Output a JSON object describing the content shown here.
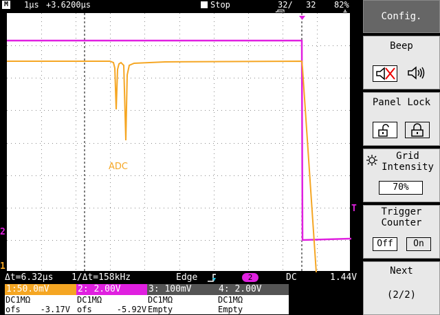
{
  "topbar": {
    "mode_icon": "M",
    "timebase": "1μs",
    "trigger_pos": "+3.6200μs",
    "run_state": "Stop",
    "record_icon": "record-icon",
    "record_count": "32/",
    "record_total": "32",
    "battery_icon": "battery-icon",
    "battery": "82%"
  },
  "plot": {
    "annotation_label": "ADC",
    "channel_colors": {
      "ch1": "#f5a623",
      "ch2": "#e020e0"
    },
    "left_marker_ch2": "2",
    "left_marker_ch1": "1",
    "trigger_marker": "T"
  },
  "infoline": {
    "delta_t": "Δt=6.32μs",
    "inv_delta_t": "1/Δt=158kHz",
    "trigger_type": "Edge",
    "trigger_source": "2",
    "coupling": "DC",
    "trigger_level": "1.44V"
  },
  "channels": [
    {
      "header": "1:50.0mV",
      "row1": "DC1MΩ",
      "row2": "ofs    -3.17V",
      "color": "#f5a623"
    },
    {
      "header": "2: 2.00V",
      "row1": "DC1MΩ",
      "row2": "ofs     -5.92V",
      "color": "#e020e0"
    },
    {
      "header": "3: 100mV",
      "row1": "DC1MΩ",
      "row2": "Empty",
      "color": "#555555"
    },
    {
      "header": "4: 2.00V",
      "row1": "DC1MΩ",
      "row2": "Empty",
      "color": "#555555"
    }
  ],
  "menu": {
    "config": "Config.",
    "beep": {
      "title": "Beep",
      "off_icon": "speaker-muted-icon",
      "on_icon": "speaker-on-icon"
    },
    "panel_lock": {
      "title": "Panel Lock",
      "unlock_icon": "unlocked-icon",
      "lock_icon": "locked-icon"
    },
    "grid_intensity": {
      "title_line1": "Grid",
      "title_line2": "Intensity",
      "value": "70%",
      "icon": "sun-icon"
    },
    "trigger_counter": {
      "title_line1": "Trigger",
      "title_line2": "Counter",
      "off": "Off",
      "on": "On"
    },
    "next": {
      "title": "Next",
      "page": "(2/2)"
    }
  }
}
